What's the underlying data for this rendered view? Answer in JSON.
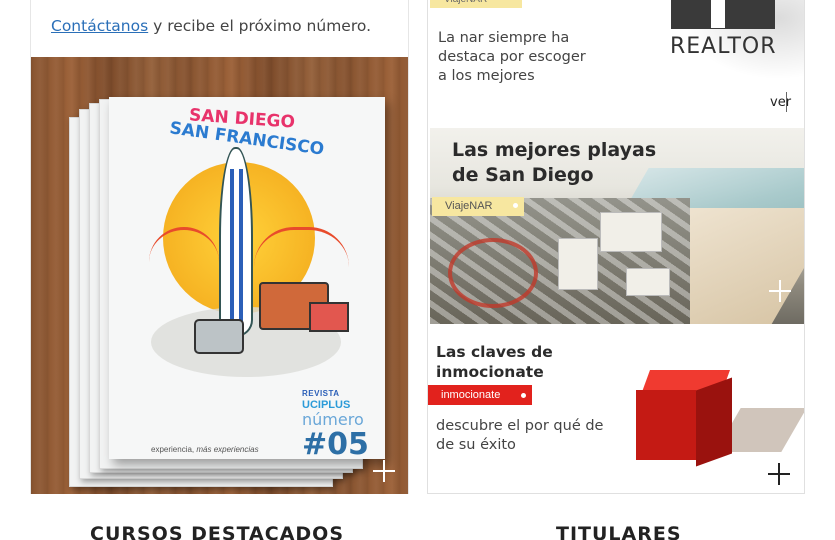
{
  "left_card": {
    "contact_link": "Contáctanos",
    "contact_rest": " y recibe el próximo número.",
    "magazine": {
      "title_line1": "SAN DIEGO",
      "title_line2": "SAN FRANCISCO",
      "revista": "REVISTA",
      "brand": "UCIPLUS",
      "numero": "número",
      "issue": "#05",
      "tagline_a": "experiencia, ",
      "tagline_b": "más experiencias"
    }
  },
  "right_card": {
    "top_tag": "ViajeNAR",
    "nar_text": "La nar siempre ha destaca por escoger a los mejores",
    "realtor": "REALTOR",
    "ver_link": "ver",
    "beach_title_line1": "Las mejores playas",
    "beach_title_line2": "de San Diego",
    "beach_tag": "ViajeNAR",
    "claves_title_line1": "Las claves de",
    "claves_title_line2": "inmocionate",
    "claves_tag": "inmocionate",
    "claves_text": "descubre el por qué de de su éxito"
  },
  "sections": {
    "cursos": "CURSOS DESTACADOS",
    "titulares": "TITULARES"
  },
  "icons": [
    "plus-icon",
    "realtor-logo-icon"
  ],
  "colors": {
    "link": "#2a6fb8",
    "tag_yellow": "#f7e7a0",
    "tag_red": "#e2221d"
  }
}
